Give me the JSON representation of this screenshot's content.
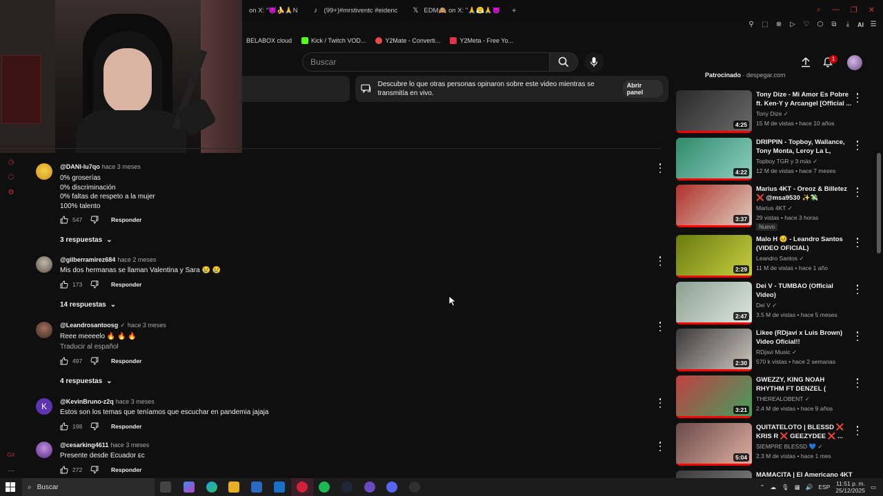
{
  "browser": {
    "tabs": [
      {
        "label": "on X: \"😈🍌🙏N"
      },
      {
        "label": "(99+)#mrstiventc #eidenc"
      },
      {
        "label": "EDM🙈 on X: \"🙏😤🙏😈"
      }
    ],
    "new_tab": "+",
    "ai_label": "AI",
    "bookmarks": [
      {
        "label": "BELABOX cloud",
        "color": "#0f0f0f"
      },
      {
        "label": "Kick / Twitch VOD...",
        "color": "#53fc18"
      },
      {
        "label": "Y2Mate - Converti...",
        "color": "#e44b4b"
      },
      {
        "label": "Y2Meta - Free Yo...",
        "color": "#e0344b"
      }
    ]
  },
  "youtube": {
    "search_placeholder": "Buscar",
    "notifications_count": "1",
    "chat_notice": "Descubre lo que otras personas opinaron sobre este video mientras se transmitía en vivo.",
    "open_panel": "Abrir panel",
    "sponsor": {
      "label": "Patrocinado",
      "domain": "despegar.com"
    }
  },
  "comments": [
    {
      "user": "@DANI-lu7qo",
      "time": "hace 3 meses",
      "text": "0% groserías\n0% discriminación\n0% faltas de respeto a la mujer\n100% talento",
      "likes": "547",
      "reply": "Responder",
      "replies": "3 respuestas",
      "avatar_color": "#e7b52a"
    },
    {
      "user": "@gilberramirez684",
      "time": "hace 2 meses",
      "text": "Mis dos hermanas se llaman Valentina y Sara 😢 😢",
      "likes": "173",
      "reply": "Responder",
      "replies": "14 respuestas",
      "avatar_color": "#8a8070"
    },
    {
      "user": "@Leandrosantoosg",
      "time": "hace 3 meses",
      "text": "Reee meeeelo 🔥 🔥 🔥",
      "translate": "Traducir al español",
      "likes": "497",
      "reply": "Responder",
      "replies": "4 respuestas",
      "avatar_color": "#6b4a3a"
    },
    {
      "user": "@KevinBruno-z2q",
      "time": "hace 3 meses",
      "text": "Estos son los temas que teníamos que escuchar en pandemia jajaja",
      "likes": "198",
      "reply": "Responder",
      "avatar_letter": "K",
      "avatar_color": "#5e35b1"
    },
    {
      "user": "@cesarking4611",
      "time": "hace 3 meses",
      "text": "Presente desde Ecuador ᴇᴄ",
      "likes": "272",
      "reply": "Responder",
      "avatar_color": "#7b3fa0"
    }
  ],
  "videos": [
    {
      "title": "Tony Dize - Mi Amor Es Pobre ft. Ken-Y y Arcangel [Official ...",
      "channel": "Tony Dize",
      "meta": "15 M de vistas • hace 10 años",
      "duration": "4:25",
      "c1": "#2a2a2a",
      "c2": "#6a6a6a"
    },
    {
      "title": "DRIPPIN - Topboy, Wallance, Tony Monta, Leroy La L, Farid...",
      "channel": "Topboy TGR",
      "channel_extra": "y 3 más",
      "meta": "12 M de vistas • hace 7 meses",
      "duration": "4:22",
      "c1": "#2f8a6a",
      "c2": "#8fd0c0"
    },
    {
      "title": "Marius 4KT - Oreoz & Billetez ❌ @msa9530 ✨💸",
      "channel": "Marius 4KT",
      "meta": "29 vistas • hace 3 horas",
      "badge": "Nuevo",
      "duration": "3:37",
      "c1": "#b0302a",
      "c2": "#e0d0c0"
    },
    {
      "title": "Malo H 😣 - Leandro Santos (VIDEO OFICIAL)",
      "channel": "Leandro Santos",
      "meta": "11 M de vistas • hace 1 año",
      "duration": "2:29",
      "c1": "#6a7a10",
      "c2": "#c8d040"
    },
    {
      "title": "Dei V - TUMBAO (Official Video)",
      "channel": "Dei V",
      "meta": "3.5 M de vistas • hace 5 meses",
      "duration": "2:47",
      "c1": "#8aa090",
      "c2": "#e0e8e0"
    },
    {
      "title": "Likee (RDjavi x Luis Brown) Video Oficial!!",
      "channel": "RDjavi Music",
      "meta": "570 k vistas • hace 2 semanas",
      "duration": "2:30",
      "c1": "#3a3a3a",
      "c2": "#d0c8c0"
    },
    {
      "title": "GWEZZY, KING NOAH RHYTHM FT DENZEL ( OFFICIAL AUDIO )",
      "channel": "THEREALOBENT",
      "meta": "2.4 M de vistas • hace 9 años",
      "duration": "3:21",
      "c1": "#c04040",
      "c2": "#40a060"
    },
    {
      "title": "QUITATELOTO | BLESSD ❌ KRIS R ❌ GEEZYDEE ❌ ...",
      "channel": "SIEMPRE BLESSD 💙",
      "meta": "2.3 M de vistas • hace 1 mes",
      "duration": "5:04",
      "c1": "#6a4a4a",
      "c2": "#e0b0a0"
    },
    {
      "title": "MAMACITA | El Americano 4KT",
      "channel": "",
      "meta": "",
      "duration": "",
      "c1": "#3a3a3a",
      "c2": "#888888"
    }
  ],
  "taskbar": {
    "search_placeholder": "Buscar",
    "language": "ESP",
    "time": "11:51 p. m.",
    "date": "25/12/2025"
  }
}
